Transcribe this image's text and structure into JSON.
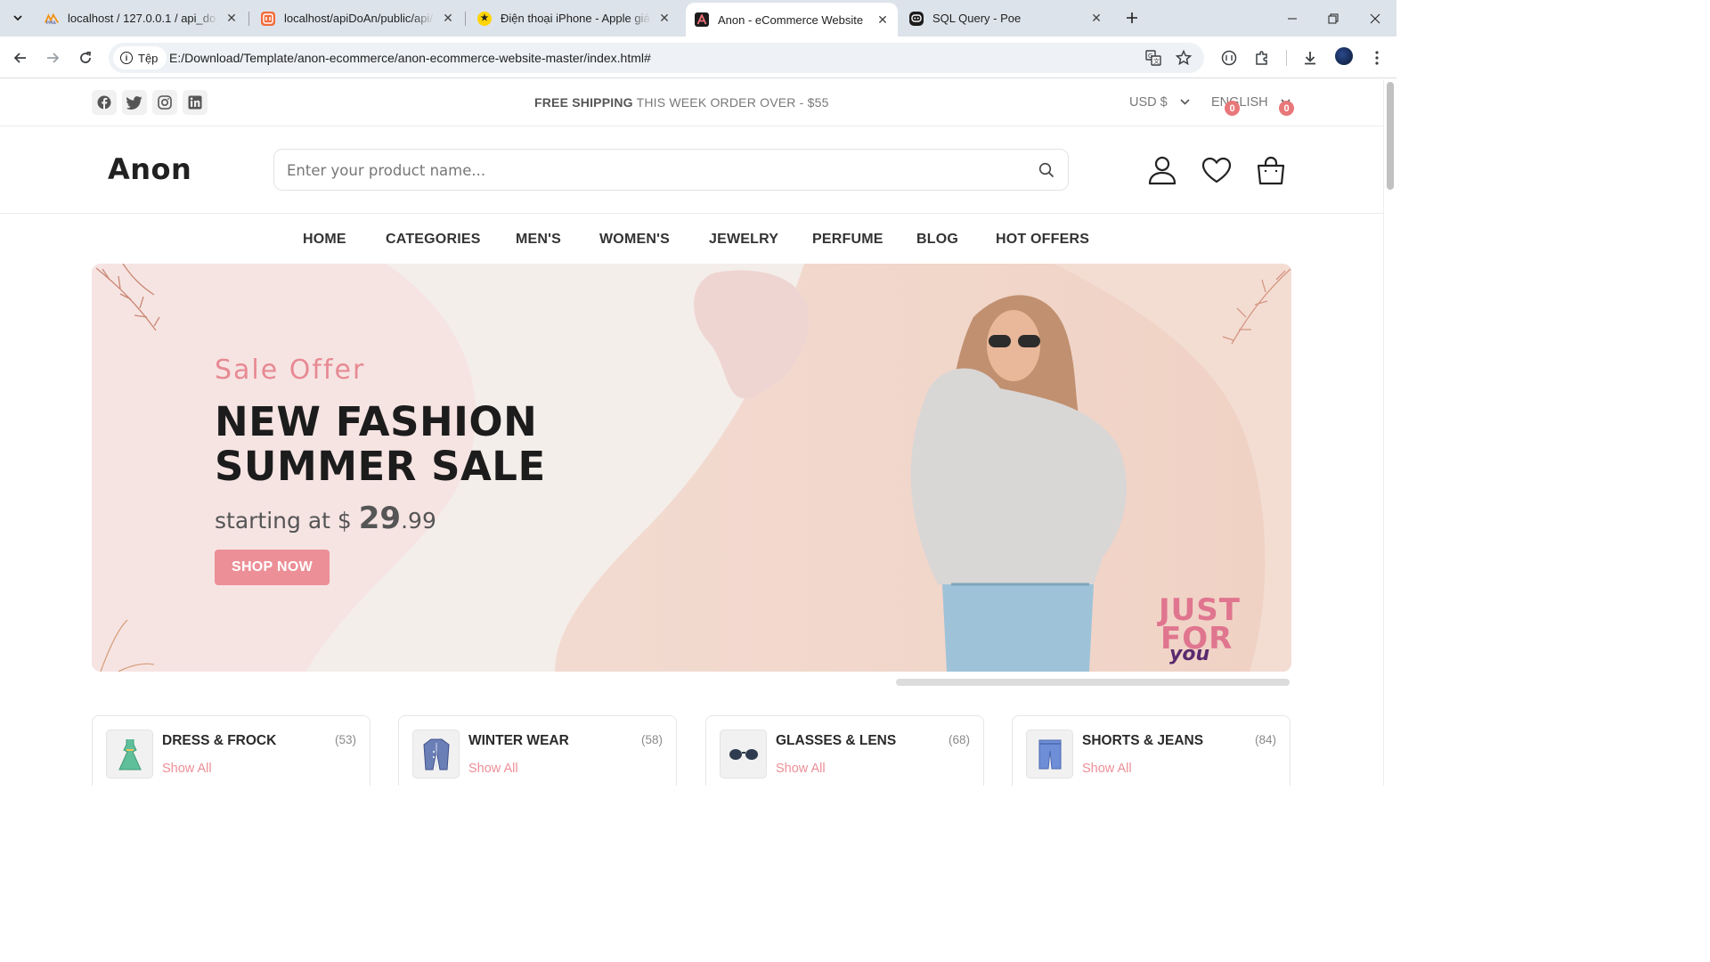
{
  "browser": {
    "tabs": [
      {
        "title": "localhost / 127.0.0.1 / api_do_an",
        "favicon": "phpmyadmin-icon",
        "active": false
      },
      {
        "title": "localhost/apiDoAn/public/api/",
        "favicon": "postman-like-icon",
        "active": false
      },
      {
        "title": "Điện thoại iPhone - Apple giá rẻ",
        "favicon": "thegioididong-icon",
        "active": false
      },
      {
        "title": "Anon - eCommerce Website",
        "favicon": "anon-icon",
        "active": true
      },
      {
        "title": "SQL Query - Poe",
        "favicon": "poe-icon",
        "active": false
      }
    ],
    "site_chip": "Tệp",
    "url": "E:/Download/Template/anon-ecommerce/anon-ecommerce-website-master/index.html#"
  },
  "topbar": {
    "promo_bold": "FREE SHIPPING",
    "promo_rest": " THIS WEEK ORDER OVER - $55",
    "currency": "USD $",
    "language": "ENGLISH",
    "social": [
      "facebook-icon",
      "twitter-icon",
      "instagram-icon",
      "linkedin-icon"
    ]
  },
  "header": {
    "logo": "Anon",
    "search_placeholder": "Enter your product name...",
    "wishlist_count": "0",
    "cart_count": "0"
  },
  "nav": [
    "HOME",
    "CATEGORIES",
    "MEN'S",
    "WOMEN'S",
    "JEWELRY",
    "PERFUME",
    "BLOG",
    "HOT OFFERS"
  ],
  "hero": {
    "subtitle": "Sale Offer",
    "title_line1": "NEW FASHION",
    "title_line2": "SUMMER SALE",
    "price_prefix": "starting at $ ",
    "price_whole": "29",
    "price_cents": ".99",
    "button": "SHOP NOW",
    "stamp_line1": "JUST",
    "stamp_line2": "FOR",
    "stamp_line3": "you"
  },
  "categories": [
    {
      "name": "DRESS & FROCK",
      "count": "(53)",
      "link": "Show All",
      "icon": "dress-icon"
    },
    {
      "name": "WINTER WEAR",
      "count": "(58)",
      "link": "Show All",
      "icon": "coat-icon"
    },
    {
      "name": "GLASSES & LENS",
      "count": "(68)",
      "link": "Show All",
      "icon": "glasses-icon"
    },
    {
      "name": "SHORTS & JEANS",
      "count": "(84)",
      "link": "Show All",
      "icon": "shorts-icon"
    }
  ],
  "colors": {
    "accent": "#ec8f97",
    "badge": "#e8777a",
    "hero_bg": "#f2e2df",
    "text_dark": "#212121"
  }
}
